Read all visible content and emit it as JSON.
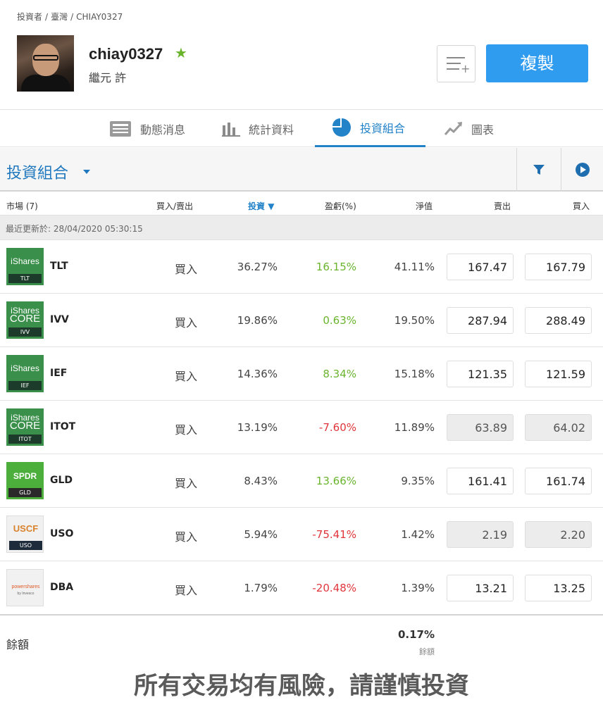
{
  "breadcrumb": [
    "投資者",
    "/",
    "臺灣",
    "/",
    "CHIAY0327"
  ],
  "profile": {
    "username": "chiay0327",
    "real_name": "繼元 許",
    "copy_label": "複製"
  },
  "tabs": [
    {
      "label": "動態消息",
      "icon": "news-feed-icon"
    },
    {
      "label": "統計資料",
      "icon": "bar-chart-icon"
    },
    {
      "label": "投資組合",
      "icon": "pie-chart-icon",
      "active": true
    },
    {
      "label": "圖表",
      "icon": "trend-chart-icon"
    }
  ],
  "section": {
    "title": "投資組合"
  },
  "columns": {
    "market": "市場 (7)",
    "side": "買入/賣出",
    "invest": "投資",
    "pnl": "盈虧(%)",
    "value": "淨值",
    "sell": "賣出",
    "buy": "買入"
  },
  "last_updated": "最近更新於: 28/04/2020 05:30:15",
  "rows": [
    {
      "ticker": "TLT",
      "logo": "iShares",
      "logo_tag": "TLT",
      "side": "買入",
      "invest": "36.27%",
      "pnl": "16.15%",
      "value": "41.11%",
      "sell": "167.47",
      "buy": "167.79"
    },
    {
      "ticker": "IVV",
      "logo": "iShares",
      "logo_sub": "CORE",
      "logo_tag": "IVV",
      "side": "買入",
      "invest": "19.86%",
      "pnl": "0.63%",
      "value": "19.50%",
      "sell": "287.94",
      "buy": "288.49"
    },
    {
      "ticker": "IEF",
      "logo": "iShares",
      "logo_tag": "IEF",
      "side": "買入",
      "invest": "14.36%",
      "pnl": "8.34%",
      "value": "15.18%",
      "sell": "121.35",
      "buy": "121.59"
    },
    {
      "ticker": "ITOT",
      "logo": "iShares",
      "logo_sub": "CORE",
      "logo_tag": "ITOT",
      "side": "買入",
      "invest": "13.19%",
      "pnl": "-7.60%",
      "value": "11.89%",
      "sell": "63.89",
      "buy": "64.02"
    },
    {
      "ticker": "GLD",
      "logo": "SPDR",
      "logo_tag": "GLD",
      "side": "買入",
      "invest": "8.43%",
      "pnl": "13.66%",
      "value": "9.35%",
      "sell": "161.41",
      "buy": "161.74"
    },
    {
      "ticker": "USO",
      "logo": "USCF",
      "logo_tag": "USO",
      "side": "買入",
      "invest": "5.94%",
      "pnl": "-75.41%",
      "value": "1.42%",
      "sell": "2.19",
      "buy": "2.20"
    },
    {
      "ticker": "DBA",
      "logo": "powershares",
      "logo_tag": "by Invesco",
      "side": "買入",
      "invest": "1.79%",
      "pnl": "-20.48%",
      "value": "1.39%",
      "sell": "13.21",
      "buy": "13.25"
    }
  ],
  "footer": {
    "label": "餘額",
    "cash_value": "0.17%",
    "cash_sub": "餘額"
  },
  "disclaimer": "所有交易均有風險，請謹慎投資",
  "colors": {
    "accent": "#2383c9",
    "copy_button": "#2f9cf0",
    "positive": "#6ab42d",
    "negative": "#e0353b",
    "ishares_green": "#3a8f4a",
    "spdr_green": "#4caf3c"
  }
}
